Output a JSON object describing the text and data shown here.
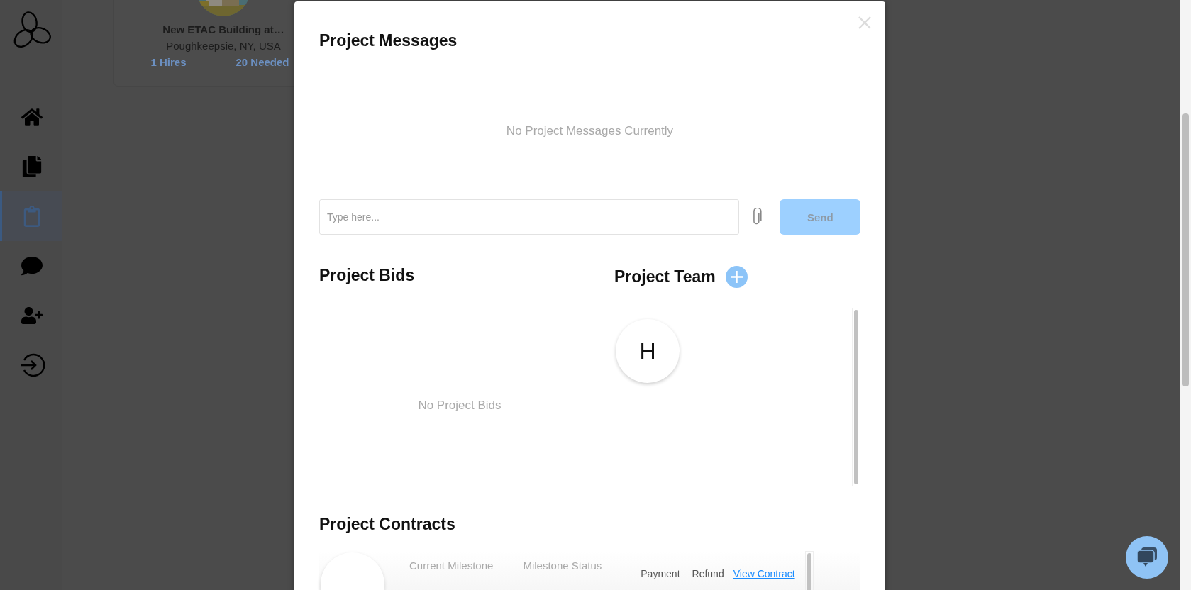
{
  "sidebar": {
    "items": [
      {
        "kind": "home",
        "selected": false
      },
      {
        "kind": "documents",
        "selected": false
      },
      {
        "kind": "clipboard",
        "selected": true
      },
      {
        "kind": "chat",
        "selected": false
      },
      {
        "kind": "add-user",
        "selected": false
      },
      {
        "kind": "sign-in",
        "selected": false
      }
    ]
  },
  "project_card": {
    "title": "New ETAC Building at…",
    "location": "Poughkeepsie, NY, USA",
    "hires": "1 Hires",
    "needed": "20 Needed"
  },
  "modal": {
    "messages": {
      "title": "Project Messages",
      "empty": "No Project Messages Currently",
      "input": {
        "placeholder": "Type here..."
      },
      "send": "Send"
    },
    "bids": {
      "title": "Project Bids",
      "empty": "No Project Bids"
    },
    "team": {
      "title": "Project Team",
      "members": [
        {
          "initial": "H"
        }
      ]
    },
    "contracts": {
      "title": "Project Contracts",
      "columns": [
        "Current Milestone",
        "Milestone Status"
      ],
      "actions": [
        "Payment",
        "Refund"
      ],
      "link": "View Contract"
    }
  }
}
